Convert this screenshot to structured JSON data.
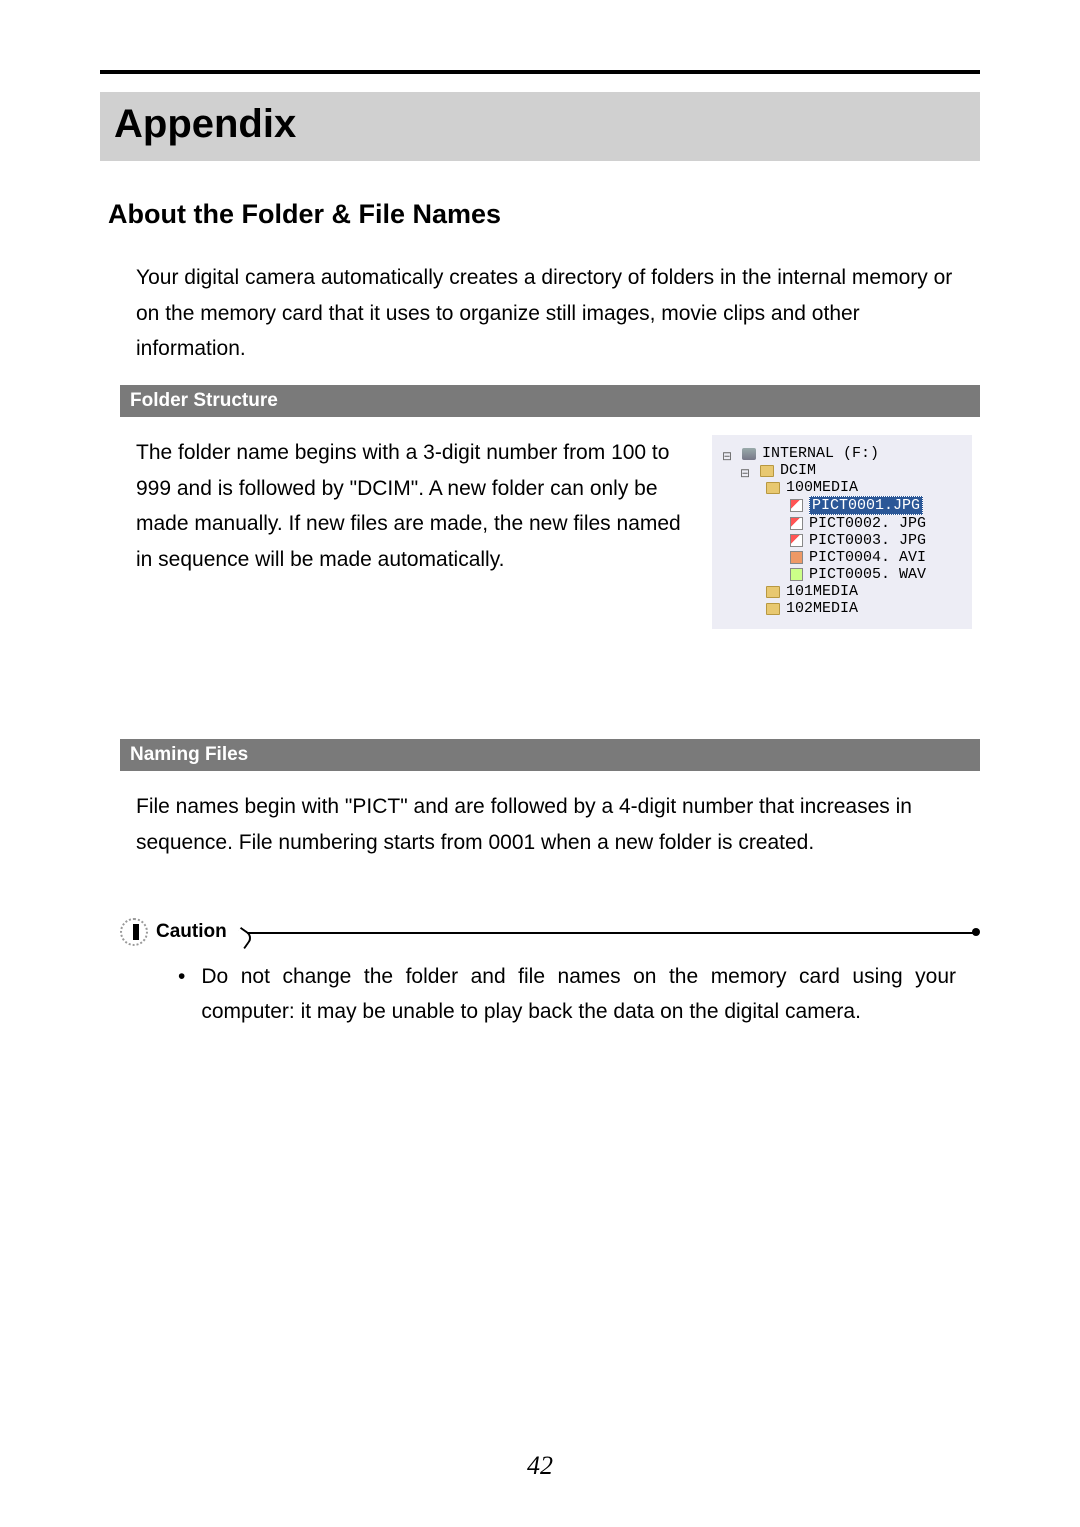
{
  "appendix_title": "Appendix",
  "section_title": "About the Folder & File Names",
  "intro_text": "Your digital camera automatically creates a directory of folders in the internal memory or on the memory card that it uses to organize still images, movie clips and other information.",
  "sub1_title": "Folder Structure",
  "folder_text": "The folder name begins with a 3-digit number from 100 to 999 and is followed by \"DCIM\". A new folder can only be made manually. If new files are made, the new files named in sequence will be made automatically.",
  "tree": {
    "root": "INTERNAL (F:)",
    "dcim": "DCIM",
    "m100": "100MEDIA",
    "f1": "PICT0001.JPG",
    "f2": "PICT0002. JPG",
    "f3": "PICT0003. JPG",
    "f4": "PICT0004. AVI",
    "f5": "PICT0005. WAV",
    "m101": "101MEDIA",
    "m102": "102MEDIA"
  },
  "sub2_title": "Naming Files",
  "naming_text": "File names begin with \"PICT\" and are followed by a 4-digit number that increases in sequence. File numbering starts from 0001 when a new folder is created.",
  "caution_label": "Caution",
  "caution_text": "Do not change the folder and file names on the memory card using your computer: it may be unable to play back the data on the digital camera.",
  "page_number": "42"
}
